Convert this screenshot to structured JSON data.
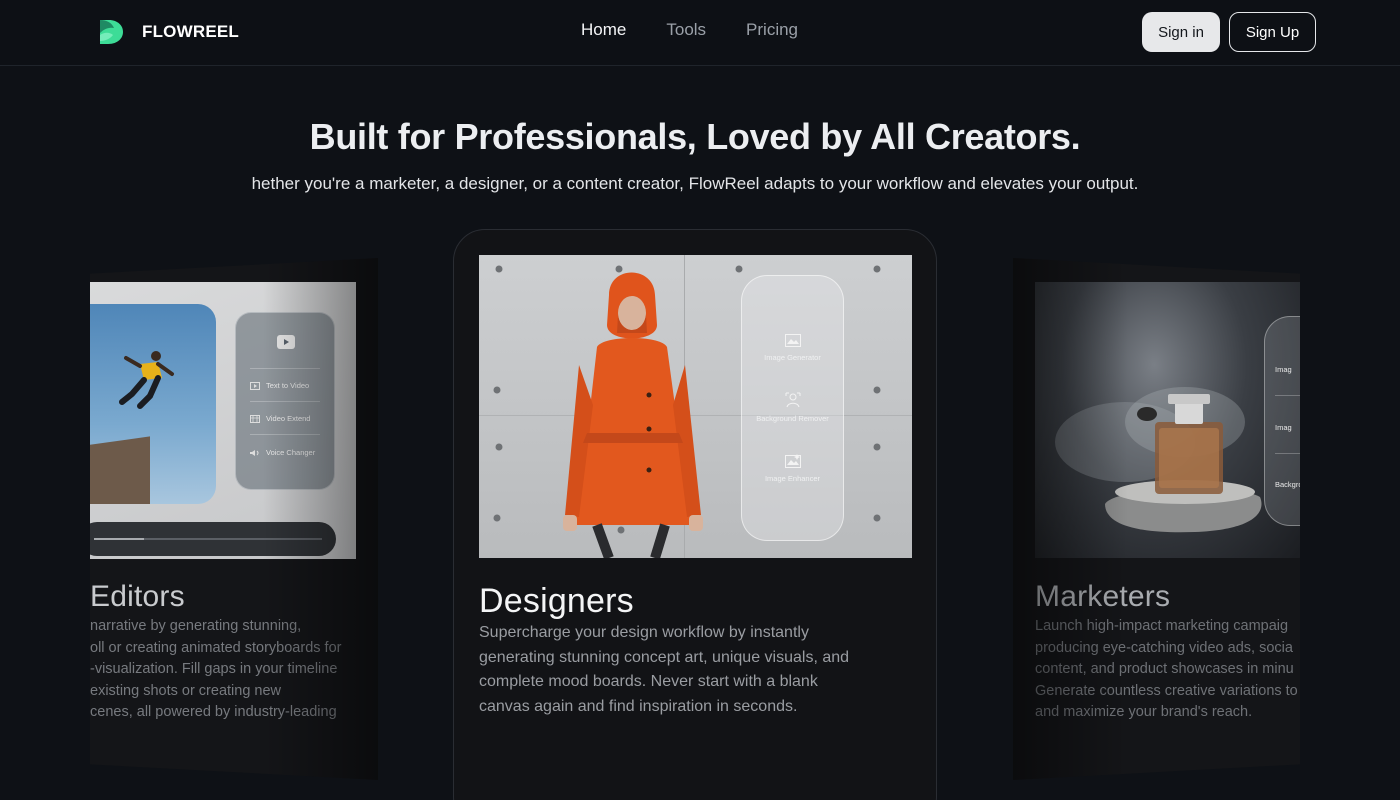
{
  "brand": {
    "name": "FLOWREEL",
    "accent": "#3ddc97"
  },
  "nav": {
    "links": [
      {
        "label": "Home",
        "active": true
      },
      {
        "label": "Tools",
        "active": false
      },
      {
        "label": "Pricing",
        "active": false
      }
    ],
    "sign_in": "Sign in",
    "sign_up": "Sign Up"
  },
  "hero": {
    "title": "Built for Professionals, Loved by All Creators.",
    "subtitle": "hether you're a marketer, a designer, or a content creator, FlowReel adapts to your workflow and elevates your output."
  },
  "cards": {
    "left": {
      "title": "Editors",
      "desc_lines": [
        "narrative by generating stunning,",
        "oll or creating animated storyboards for",
        "-visualization. Fill gaps in your timeline",
        "existing shots or creating new",
        "cenes, all powered by industry-leading"
      ],
      "panel": {
        "items": [
          "Text to Video",
          "Video Extend",
          "Voice Changer"
        ],
        "icons": [
          "play-icon",
          "film-icon",
          "speaker-icon"
        ]
      }
    },
    "center": {
      "title": "Designers",
      "desc_lines": [
        "Supercharge your design workflow by instantly",
        "generating stunning concept art, unique visuals, and",
        "complete mood boards. Never start with a blank",
        "canvas again and find inspiration in seconds."
      ],
      "panel": {
        "items": [
          "Image Generator",
          "Background Remover",
          "Image Enhancer"
        ],
        "icons": [
          "image-icon",
          "background-remove-icon",
          "image-enhance-icon"
        ]
      }
    },
    "right": {
      "title": "Marketers",
      "desc_lines": [
        "Launch high-impact marketing campaig",
        "producing eye-catching video ads, socia",
        "content, and product showcases in minu",
        "Generate countless creative variations to",
        "and maximize your brand's reach."
      ],
      "panel": {
        "items": [
          "Imag",
          "Imag",
          "Backgro"
        ]
      }
    }
  }
}
